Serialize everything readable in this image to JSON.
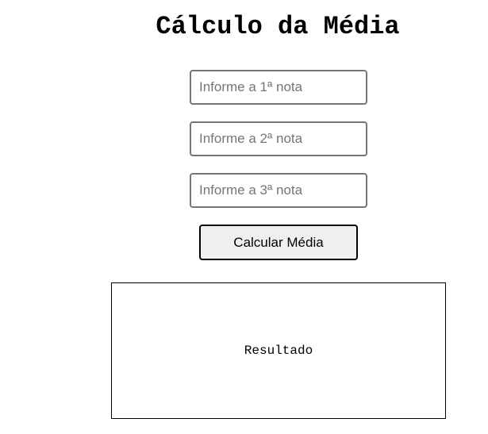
{
  "page": {
    "title": "Cálculo da Média"
  },
  "form": {
    "nota1_placeholder": "Informe a 1ª nota",
    "nota2_placeholder": "Informe a 2ª nota",
    "nota3_placeholder": "Informe a 3ª nota",
    "nota1_value": "",
    "nota2_value": "",
    "nota3_value": "",
    "calculate_label": "Calcular Média"
  },
  "result": {
    "text": "Resultado"
  }
}
